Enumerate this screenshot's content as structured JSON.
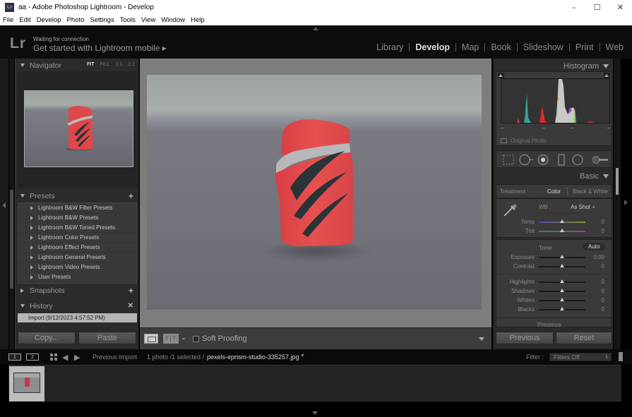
{
  "window": {
    "title": "aa - Adobe Photoshop Lightroom - Develop",
    "controls": {
      "minimize": "–",
      "maximize": "☐",
      "close": "✕"
    }
  },
  "menu": [
    "File",
    "Edit",
    "Develop",
    "Photo",
    "Settings",
    "Tools",
    "View",
    "Window",
    "Help"
  ],
  "identity": {
    "logo": "Lr",
    "status": "Waiting for connection",
    "cta": "Get started with Lightroom mobile ▸"
  },
  "modules": [
    {
      "label": "Library",
      "active": false
    },
    {
      "label": "Develop",
      "active": true
    },
    {
      "label": "Map",
      "active": false
    },
    {
      "label": "Book",
      "active": false
    },
    {
      "label": "Slideshow",
      "active": false
    },
    {
      "label": "Print",
      "active": false
    },
    {
      "label": "Web",
      "active": false
    }
  ],
  "left_panel": {
    "navigator": {
      "title": "Navigator",
      "zoom_options": [
        "FIT",
        "FILL",
        "1:1",
        "2:1"
      ],
      "zoom_selected": "FIT"
    },
    "presets": {
      "title": "Presets",
      "items": [
        "Lightroom B&W Filter Presets",
        "Lightroom B&W Presets",
        "Lightroom B&W Toned Presets",
        "Lightroom Color Presets",
        "Lightroom Effect Presets",
        "Lightroom General Presets",
        "Lightroom Video Presets",
        "User Presets"
      ]
    },
    "snapshots": {
      "title": "Snapshots"
    },
    "history": {
      "title": "History",
      "items": [
        "Import (9/12/2023 4:57:52 PM)"
      ]
    },
    "buttons": {
      "copy": "Copy...",
      "paste": "Paste"
    }
  },
  "toolbar": {
    "loupe_icon": "loupe-view-icon",
    "compare_label": "Y|Y",
    "soft_proofing_label": "Soft Proofing",
    "soft_proofing_checked": false
  },
  "right_panel": {
    "histogram": {
      "title": "Histogram",
      "original_photo_label": "Original Photo",
      "original_photo_checked": false
    },
    "tools": [
      "crop-overlay",
      "spot-removal",
      "red-eye",
      "graduated-filter",
      "radial-filter",
      "adjustment-brush"
    ],
    "basic": {
      "title": "Basic",
      "treatment_label": "Treatment :",
      "treatment_options": [
        "Color",
        "Black & White"
      ],
      "treatment_selected": "Color",
      "wb_label": "WB :",
      "wb_value": "As Shot ÷",
      "tone_label": "Tone",
      "auto_label": "Auto",
      "presence_label": "Presence",
      "sliders": [
        {
          "label": "Temp",
          "value": "0",
          "position": 0.5,
          "group": "wb"
        },
        {
          "label": "Tint",
          "value": "0",
          "position": 0.5,
          "group": "wb"
        },
        {
          "label": "Exposure",
          "value": "0.00",
          "position": 0.5,
          "group": "tone"
        },
        {
          "label": "Contrast",
          "value": "0",
          "position": 0.5,
          "group": "tone"
        },
        {
          "label": "Highlights",
          "value": "0",
          "position": 0.5,
          "group": "tone2"
        },
        {
          "label": "Shadows",
          "value": "0",
          "position": 0.5,
          "group": "tone2"
        },
        {
          "label": "Whites",
          "value": "0",
          "position": 0.5,
          "group": "tone2"
        },
        {
          "label": "Blacks",
          "value": "0",
          "position": 0.5,
          "group": "tone2"
        }
      ]
    },
    "buttons": {
      "previous": "Previous",
      "reset": "Reset"
    }
  },
  "filmstrip_bar": {
    "view1": "1",
    "view2": "2",
    "source": "Previous Import",
    "count": "1 photo /1 selected /",
    "filename": "pexels-eprism-studio-335257.jpg",
    "filter_label": "Filter :",
    "filter_value": "Filters Off"
  },
  "colors": {
    "panel_bg": "#2b2b2b",
    "center_bg": "#7d7d7d",
    "product_red": "#e0474a"
  }
}
